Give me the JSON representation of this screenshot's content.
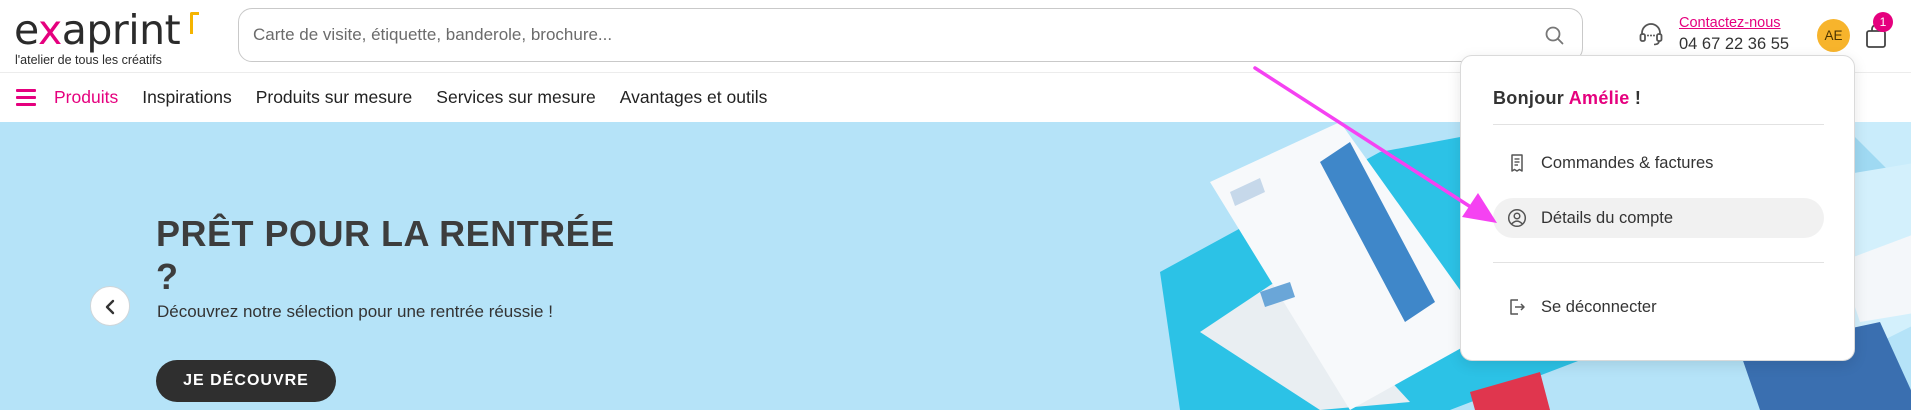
{
  "header": {
    "logo": {
      "text_before": "e",
      "text_x": "x",
      "text_after": "aprint",
      "tagline": "l'atelier de tous les créatifs"
    },
    "search": {
      "placeholder": "Carte de visite, étiquette, banderole, brochure...",
      "value": ""
    },
    "contact": {
      "link": "Contactez-nous",
      "phone": "04 67 22 36 55"
    },
    "avatar_initials": "AE",
    "cart_count": "1"
  },
  "nav": {
    "items": [
      {
        "label": "Produits",
        "active": true
      },
      {
        "label": "Inspirations",
        "active": false
      },
      {
        "label": "Produits sur mesure",
        "active": false
      },
      {
        "label": "Services sur mesure",
        "active": false
      },
      {
        "label": "Avantages et outils",
        "active": false
      }
    ]
  },
  "hero": {
    "title": "PRÊT POUR LA RENTRÉE ?",
    "subtitle": "Découvrez notre sélection pour une rentrée réussie !",
    "cta": "JE DÉCOUVRE"
  },
  "account_menu": {
    "greeting_prefix": "Bonjour",
    "user_name": "Amélie",
    "greeting_suffix": "!",
    "items": [
      {
        "label": "Commandes & factures",
        "icon": "receipt-icon"
      },
      {
        "label": "Détails du compte",
        "icon": "user-circle-icon"
      },
      {
        "label": "Se déconnecter",
        "icon": "logout-icon"
      }
    ]
  },
  "colors": {
    "brand_pink": "#e5007e",
    "hero_bg": "#b5e3f8",
    "avatar_bg": "#f7b42c",
    "annotation_arrow": "#f542f2"
  }
}
